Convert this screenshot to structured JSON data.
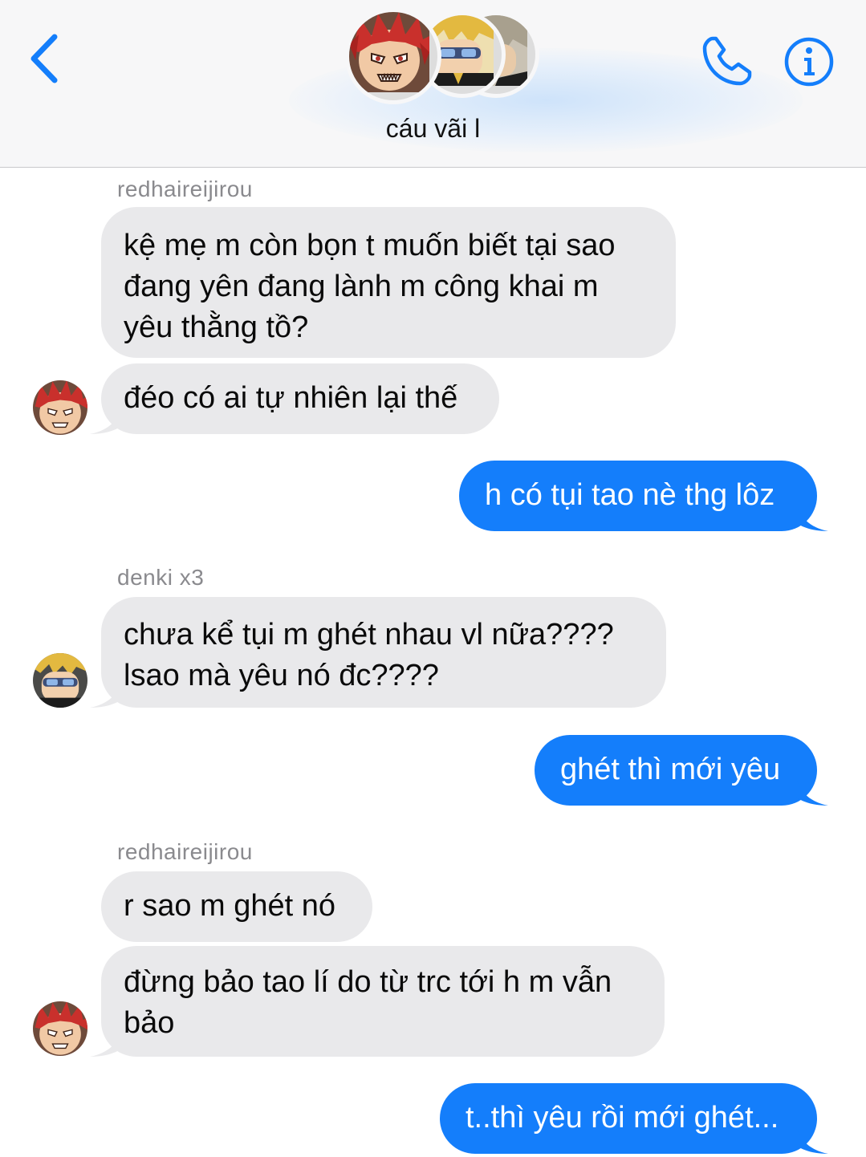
{
  "header": {
    "group_name": "cáu vãi l"
  },
  "colors": {
    "accent_blue": "#147efb",
    "incoming_bubble": "#e9e9eb",
    "sender_name_gray": "#8a8a8e"
  },
  "icons": {
    "back": "chevron-left-icon",
    "call": "phone-icon",
    "info": "info-icon"
  },
  "messages": [
    {
      "direction": "in",
      "sender": "redhaireijirou",
      "lines": [
        "kệ mẹ m còn bọn t muốn biết tại sao",
        "đang yên đang lành m công khai m",
        "yêu thằng tồ?"
      ]
    },
    {
      "direction": "in",
      "lines": [
        "đéo có ai tự nhiên lại thế"
      ]
    },
    {
      "direction": "out",
      "lines": [
        "h có tụi tao nè thg lôz"
      ]
    },
    {
      "direction": "in",
      "sender": "denki x3",
      "lines": [
        "chưa kể tụi m ghét nhau vl nữa????",
        "lsao mà yêu nó đc????"
      ]
    },
    {
      "direction": "out",
      "lines": [
        "ghét thì mới yêu"
      ]
    },
    {
      "direction": "in",
      "sender": "redhaireijirou",
      "lines": [
        "r sao m ghét nó"
      ]
    },
    {
      "direction": "in",
      "lines": [
        "đừng bảo tao lí do từ trc tới h m vẫn",
        "bảo"
      ]
    },
    {
      "direction": "out",
      "lines": [
        "t..thì yêu rồi mới ghét..."
      ]
    }
  ]
}
